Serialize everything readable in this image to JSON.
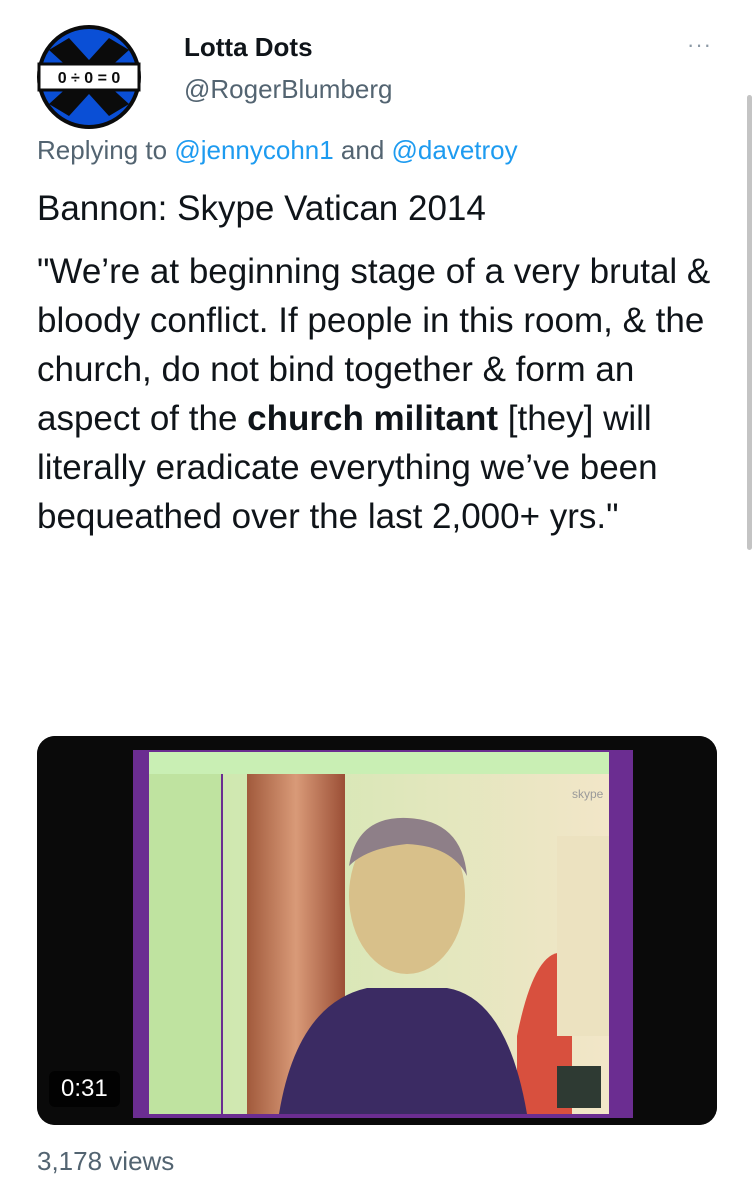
{
  "author": {
    "display_name": "Lotta Dots",
    "handle": "@RogerBlumberg",
    "avatar_text": "0 ÷ 0 = 0",
    "avatar_colors": {
      "primary": "#0a4fd6",
      "dark": "#0b0b0b"
    }
  },
  "more_icon": "···",
  "reply": {
    "prefix": "Replying to ",
    "mention1": "@jennycohn1",
    "joiner": " and ",
    "mention2": "@davetroy"
  },
  "tweet": {
    "line1": "Bannon: Skype Vatican 2014",
    "quote_start": "\"We’re at beginning stage of a very brutal & bloody conflict. If people in this room, & the church, do not bind together & form an aspect of the ",
    "quote_bold": "church militant",
    "quote_end": " [they] will literally eradicate everything we’ve been bequeathed over the last 2,000+ yrs.\""
  },
  "video": {
    "duration": "0:31",
    "watermark": "skype",
    "frame_colors": {
      "bg": "#0a0a0a",
      "purple": "#6b2d91",
      "green": "#bfe3a0"
    }
  },
  "stats": {
    "views": "3,178 views"
  },
  "colors": {
    "link": "#1d9bf0",
    "secondary": "#536471",
    "text": "#0f1419"
  }
}
